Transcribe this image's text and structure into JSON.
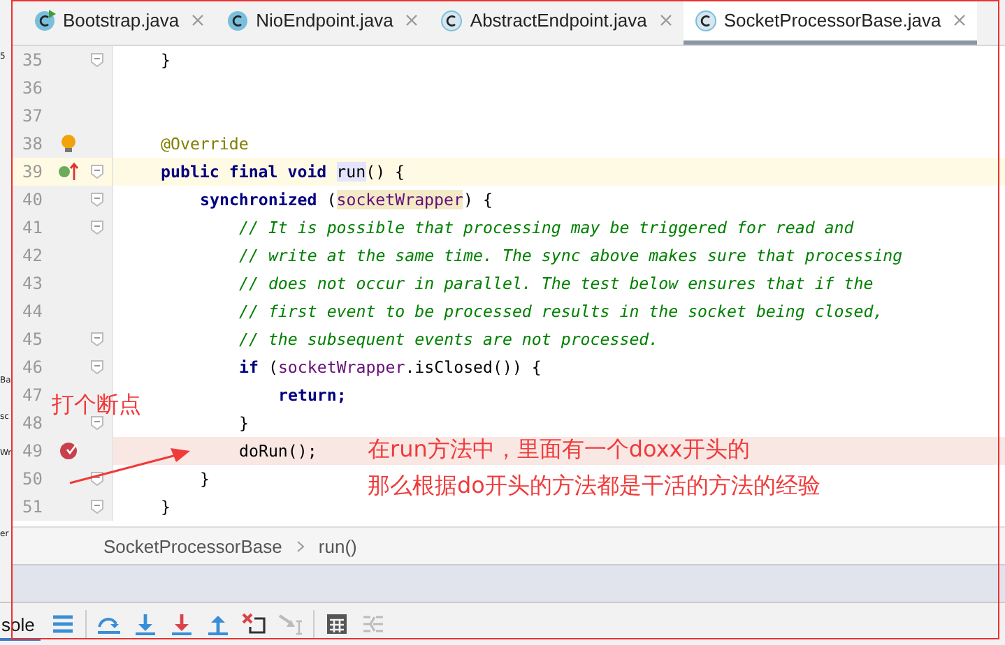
{
  "tabs": [
    {
      "label": "Bootstrap.java",
      "selected": false,
      "kind": "runnable"
    },
    {
      "label": "NioEndpoint.java",
      "selected": false,
      "kind": "class"
    },
    {
      "label": "AbstractEndpoint.java",
      "selected": false,
      "kind": "abstract"
    },
    {
      "label": "SocketProcessorBase.java",
      "selected": true,
      "kind": "abstract"
    }
  ],
  "side_fragments": [
    "5",
    "Ba",
    "sc",
    "Wr",
    "er"
  ],
  "lines": [
    {
      "number": "35",
      "fold": true,
      "segments": [
        {
          "text": "}",
          "kind": "plain"
        }
      ]
    },
    {
      "number": "36"
    },
    {
      "number": "37"
    },
    {
      "number": "38",
      "kind": "bulb",
      "segments": [
        {
          "text": "@Override",
          "kind": "annotation"
        }
      ]
    },
    {
      "number": "39",
      "kind": "override",
      "fold": true,
      "caret": true,
      "segments": [
        {
          "text": "public final void ",
          "kind": "keyword"
        },
        {
          "text": "run",
          "kind": "usage"
        },
        {
          "text": "() {",
          "kind": "plain"
        }
      ],
      "children": [
        {
          "number": "40",
          "fold": true,
          "segments": [
            {
              "text": "synchronized ",
              "kind": "keyword"
            },
            {
              "text": "(",
              "kind": "plain"
            },
            {
              "text": "socketWrapper",
              "kind": "field-usage"
            },
            {
              "text": ") {",
              "kind": "plain"
            }
          ],
          "children": [
            {
              "number": "41",
              "fold": true,
              "segments": [
                {
                  "text": "// It is possible that processing may be triggered for read and",
                  "kind": "comment"
                }
              ]
            },
            {
              "number": "42",
              "segments": [
                {
                  "text": "// write at the same time. The sync above makes sure that processing",
                  "kind": "comment"
                }
              ]
            },
            {
              "number": "43",
              "segments": [
                {
                  "text": "// does not occur in parallel. The test below ensures that if the",
                  "kind": "comment"
                }
              ]
            },
            {
              "number": "44",
              "segments": [
                {
                  "text": "// first event to be processed results in the socket being closed,",
                  "kind": "comment"
                }
              ]
            },
            {
              "number": "45",
              "fold": true,
              "segments": [
                {
                  "text": "// the subsequent events are not processed.",
                  "kind": "comment"
                }
              ]
            },
            {
              "number": "46",
              "fold": true,
              "segments": [
                {
                  "text": "if ",
                  "kind": "keyword"
                },
                {
                  "text": "(",
                  "kind": "plain"
                },
                {
                  "text": "socketWrapper",
                  "kind": "field"
                },
                {
                  "text": ".isClosed()) {",
                  "kind": "plain"
                }
              ],
              "children": [
                {
                  "number": "47",
                  "segments": [
                    {
                      "text": "return;",
                      "kind": "keyword"
                    }
                  ]
                }
              ]
            },
            {
              "number": "48",
              "fold": true,
              "segments": [
                {
                  "text": "}",
                  "kind": "plain"
                }
              ]
            },
            {
              "number": "49",
              "kind": "breakpoint",
              "segments": [
                {
                  "text": "doRun();",
                  "kind": "plain"
                }
              ]
            }
          ]
        },
        {
          "number": "50",
          "fold": true,
          "segments": [
            {
              "text": "}",
              "kind": "plain"
            }
          ]
        }
      ]
    },
    {
      "number": "51",
      "fold": true,
      "segments": [
        {
          "text": "}",
          "kind": "plain"
        }
      ]
    }
  ],
  "notes": [
    {
      "text": "打个断点"
    },
    {
      "text": "在run方法中，里面有一个doxx开头的"
    },
    {
      "text": "那么根据do开头的方法都是干活的方法的经验"
    }
  ],
  "breadcrumb": [
    "SocketProcessorBase",
    "run()"
  ],
  "console_tab": "sole",
  "toolbar": [
    {
      "kind": "lines"
    },
    {
      "kind": "sep"
    },
    {
      "kind": "step-over"
    },
    {
      "kind": "step-into"
    },
    {
      "kind": "force-step-into"
    },
    {
      "kind": "step-out"
    },
    {
      "kind": "drop-frame"
    },
    {
      "kind": "run-to-cursor",
      "disabled": true
    },
    {
      "kind": "sep"
    },
    {
      "kind": "evaluate"
    },
    {
      "kind": "trace",
      "disabled": true
    }
  ]
}
